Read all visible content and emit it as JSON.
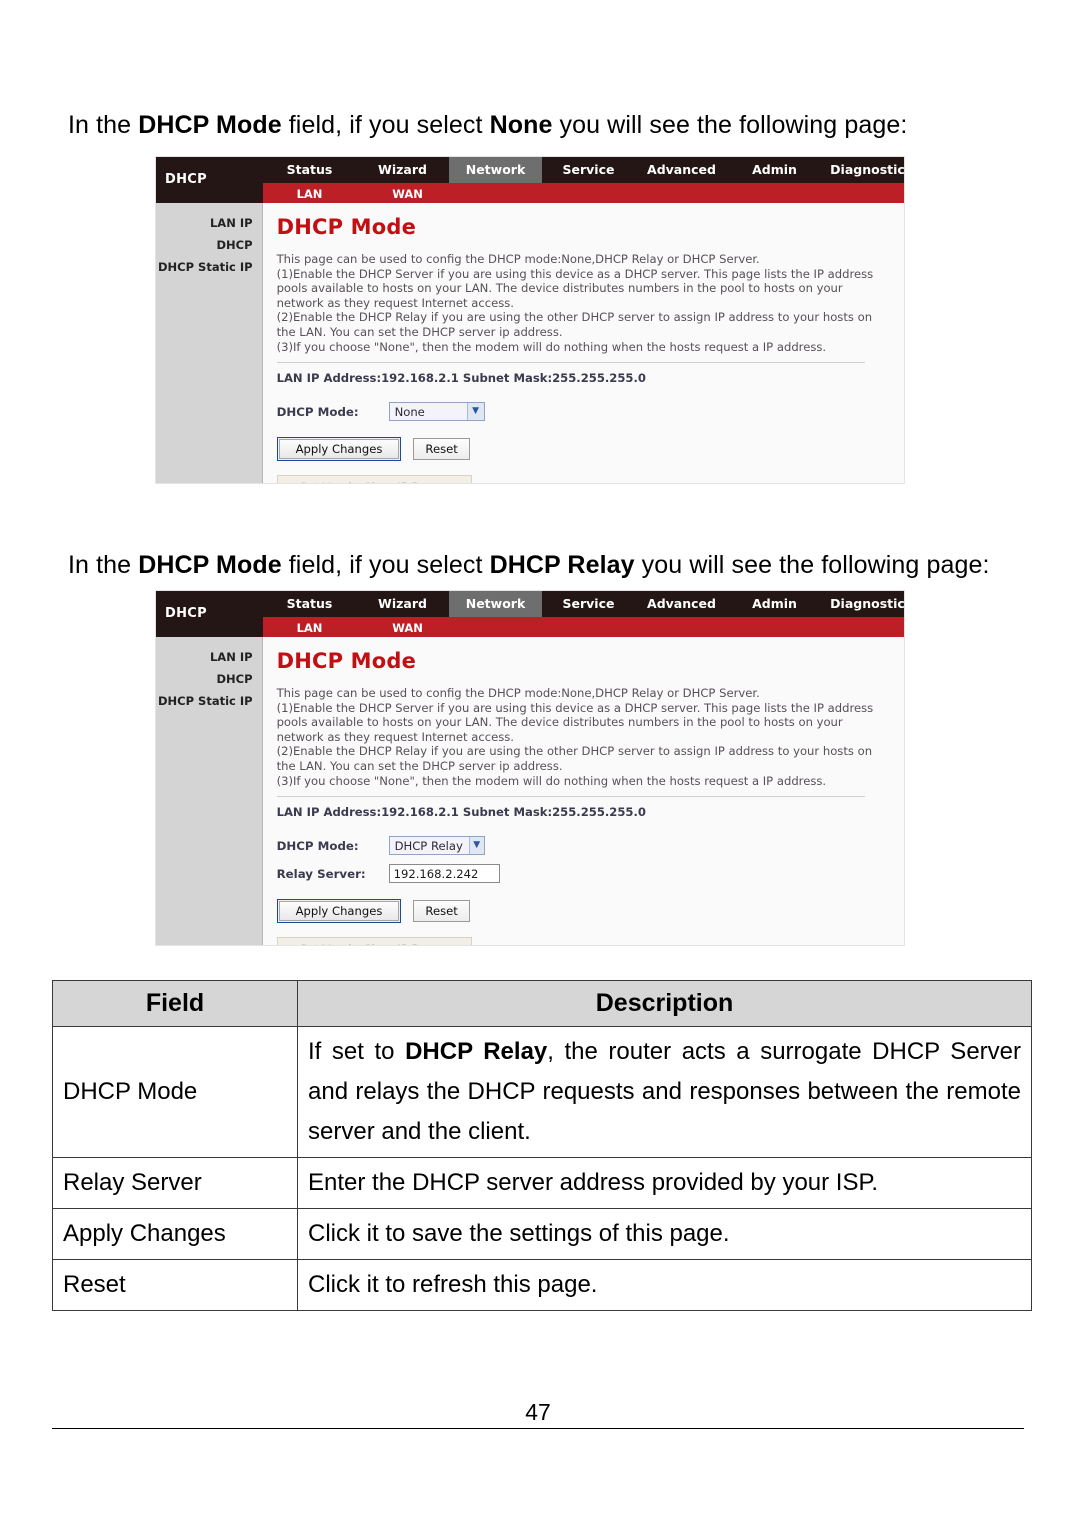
{
  "document": {
    "page_number": "47",
    "intro_none": {
      "part1": "In the ",
      "bold1": "DHCP Mode",
      "part2": " field, if you select ",
      "bold2": "None",
      "part3": " you will see the following page:"
    },
    "intro_relay": {
      "part1": "In the ",
      "bold1": "DHCP Mode",
      "part2": " field, if you select ",
      "bold2": "DHCP Relay",
      "part3": " you will see the following page:"
    }
  },
  "router_ui": {
    "brand": "DHCP",
    "nav_tabs": [
      {
        "label": "Status",
        "active": false
      },
      {
        "label": "Wizard",
        "active": false
      },
      {
        "label": "Network",
        "active": true
      },
      {
        "label": "Service",
        "active": false
      },
      {
        "label": "Advanced",
        "active": false
      },
      {
        "label": "Admin",
        "active": false
      },
      {
        "label": "Diagnostic",
        "active": false
      }
    ],
    "sub_tabs": [
      "LAN",
      "WAN"
    ],
    "sidebar_items": [
      "LAN IP",
      "DHCP",
      "DHCP Static IP"
    ],
    "page_title": "DHCP Mode",
    "description": "This page can be used to config the DHCP mode:None,DHCP Relay or DHCP Server.\n(1)Enable the DHCP Server if you are using this device as a DHCP server. This page lists the IP address pools available to hosts on your LAN. The device distributes numbers in the pool to hosts on your network as they request Internet access.\n(2)Enable the DHCP Relay if you are using the other DHCP server to assign IP address to your hosts on the LAN. You can set the DHCP server ip address.\n(3)If you choose \"None\", then the modem will do nothing when the hosts request a IP address.",
    "lan_ip_line": "LAN IP Address:192.168.2.1   Subnet Mask:255.255.255.0",
    "dhcp_mode_label": "DHCP Mode:",
    "relay_server_label": "Relay Server:",
    "apply_button": "Apply Changes",
    "reset_button": "Reset",
    "vendorclass_button": "Set VendorClass IP Range",
    "colors": {
      "nav_background": "#231614",
      "active_tab": "#6e6e6e",
      "sub_nav_red": "#bc2026",
      "title_red": "#c20f13",
      "sidebar_gray": "#d4d4d4"
    }
  },
  "screenshot_none": {
    "dhcp_mode_value": "None"
  },
  "screenshot_relay": {
    "dhcp_mode_value": "DHCP Relay",
    "relay_server_value": "192.168.2.242"
  },
  "field_table": {
    "headers": [
      "Field",
      "Description"
    ],
    "rows": [
      {
        "field": "DHCP Mode",
        "desc_pre": "If set to ",
        "desc_bold": "DHCP Relay",
        "desc_post": ", the router acts a surrogate DHCP Server and relays the DHCP requests and responses between the remote server and the client."
      },
      {
        "field": "Relay Server",
        "desc": "Enter the DHCP server address provided by your ISP."
      },
      {
        "field": "Apply Changes",
        "desc": "Click it to save the settings of this page."
      },
      {
        "field": "Reset",
        "desc": "Click it to refresh this page."
      }
    ]
  }
}
